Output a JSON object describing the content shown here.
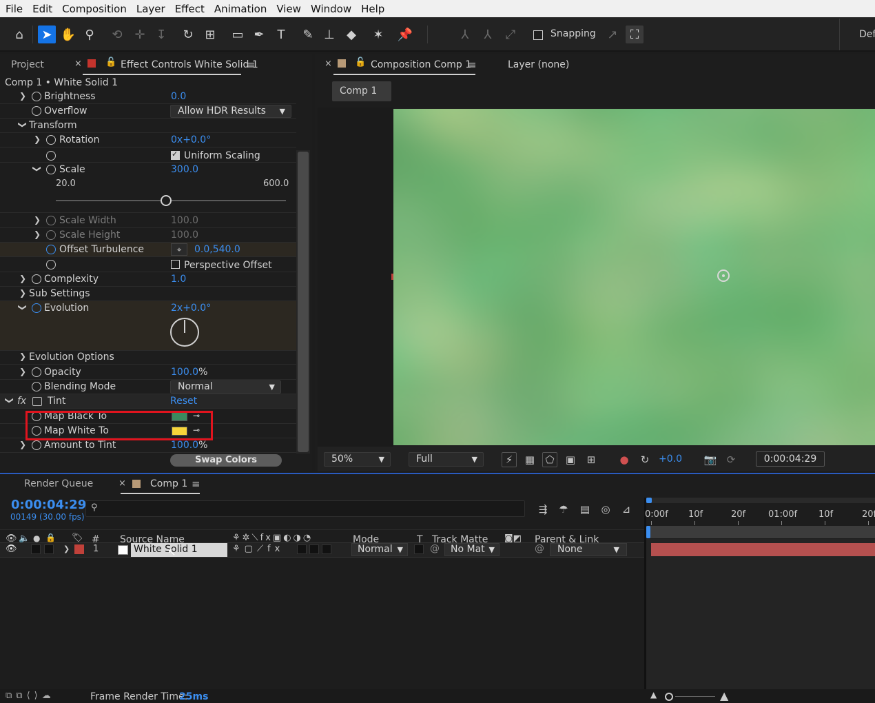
{
  "menu": [
    "File",
    "Edit",
    "Composition",
    "Layer",
    "Effect",
    "Animation",
    "View",
    "Window",
    "Help"
  ],
  "toolbar": {
    "snapping_label": "Snapping",
    "workspace_label": "Def",
    "icons": [
      "home-icon",
      "selection-icon",
      "hand-icon",
      "zoom-icon",
      "orbit-icon",
      "pan-behind-icon",
      "dolly-icon",
      "rotate-icon",
      "anchor-icon",
      "rectangle-icon",
      "pen-icon",
      "type-icon",
      "brush-icon",
      "clone-stamp-icon",
      "eraser-icon",
      "roto-brush-icon",
      "puppet-pin-icon"
    ]
  },
  "project_panel": {
    "project_tab": "Project",
    "effect_controls_tab": "Effect Controls White Solid 1",
    "breadcrumb": "Comp 1 • White Solid 1",
    "rows": {
      "brightness": {
        "label": "Brightness",
        "value": "0.0"
      },
      "overflow": {
        "label": "Overflow",
        "value": "Allow HDR Results"
      },
      "transform": {
        "label": "Transform"
      },
      "rotation": {
        "label": "Rotation",
        "value": "0x+0.0°"
      },
      "uniform_scaling": {
        "label": "Uniform Scaling",
        "checked": true
      },
      "scale": {
        "label": "Scale",
        "value": "300.0",
        "min": "20.0",
        "max": "600.0",
        "fraction": 0.48
      },
      "scale_width": {
        "label": "Scale Width",
        "value": "100.0"
      },
      "scale_height": {
        "label": "Scale Height",
        "value": "100.0"
      },
      "offset_turbulence": {
        "label": "Offset Turbulence",
        "value": "0.0,540.0"
      },
      "perspective_offset": {
        "label": "Perspective Offset",
        "checked": false
      },
      "complexity": {
        "label": "Complexity",
        "value": "1.0"
      },
      "sub_settings": {
        "label": "Sub Settings"
      },
      "evolution": {
        "label": "Evolution",
        "value": "2x+0.0°"
      },
      "evolution_options": {
        "label": "Evolution Options"
      },
      "opacity": {
        "label": "Opacity",
        "value": "100.0",
        "unit": "%"
      },
      "blending_mode": {
        "label": "Blending Mode",
        "value": "Normal"
      },
      "tint": {
        "fx": "fx",
        "label": "Tint",
        "reset": "Reset"
      },
      "map_black_to": {
        "label": "Map Black To",
        "color": "#3b8a5e"
      },
      "map_white_to": {
        "label": "Map White To",
        "color": "#f7d53a"
      },
      "amount_to_tint": {
        "label": "Amount to Tint",
        "value": "100.0",
        "unit": "%"
      },
      "swap_colors": {
        "label": "Swap Colors"
      }
    },
    "highlight_color": "#e0141e"
  },
  "composition_panel": {
    "comp_tab": "Composition Comp 1",
    "layer_tab": "Layer (none)",
    "breadcrumb_button": "Comp 1",
    "zoom": "50%",
    "resolution": "Full",
    "exposure": "+0.0",
    "timecode": "0:00:04:29"
  },
  "timeline": {
    "render_queue_tab": "Render Queue",
    "comp_tab": "Comp 1",
    "timecode": "0:00:04:29",
    "frame_info": "00149 (30.00 fps)",
    "search_placeholder": "",
    "columns": {
      "num": "#",
      "source_name": "Source Name",
      "mode": "Mode",
      "t": "T",
      "track_matte": "Track Matte",
      "parent": "Parent & Link"
    },
    "ruler": [
      "0:00f",
      "10f",
      "20f",
      "01:00f",
      "10f",
      "20f"
    ],
    "layer": {
      "number": "1",
      "name": "White Solid 1",
      "mode": "Normal",
      "track_matte": "No Mat",
      "parent": "None",
      "label_color": "#c0413a"
    },
    "status": {
      "label": "Frame Render Time:",
      "value": "25ms"
    }
  },
  "colors": {
    "accent_blue": "#3b8ef0",
    "layer_bar": "#b5504f"
  }
}
